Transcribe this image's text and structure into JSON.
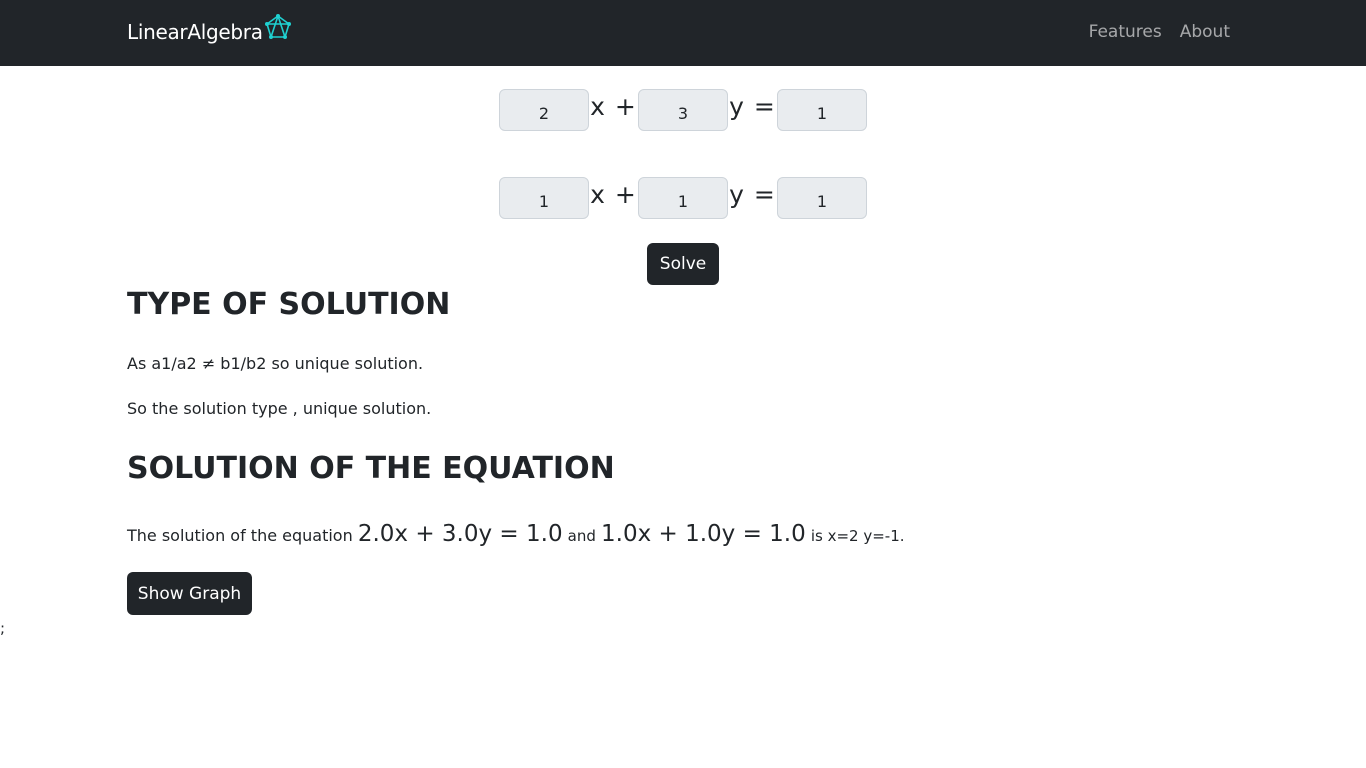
{
  "navbar": {
    "brand": "LinearAlgebra",
    "brand_icon": "pentagon-graph-logo",
    "links": [
      "Features",
      "About"
    ]
  },
  "equations": [
    {
      "a": "2",
      "b": "3",
      "c": "1"
    },
    {
      "a": "1",
      "b": "1",
      "c": "1"
    }
  ],
  "operators": {
    "x_plus": "x +",
    "y_eq": "y ="
  },
  "solve_label": "Solve",
  "type_section": {
    "heading": "TYPE OF SOLUTION",
    "line1": "As a1/a2 ≠ b1/b2 so unique solution.",
    "line2": "So the solution type , unique solution."
  },
  "solution_section": {
    "heading": "SOLUTION OF THE EQUATION",
    "prefix": "The solution of the equation",
    "eq1": "2.0x + 3.0y = 1.0",
    "connector": "and",
    "eq2": "1.0x + 1.0y = 1.0",
    "result": "is x=2 y=-1."
  },
  "show_graph_label": "Show Graph",
  "stray_text": ";",
  "colors": {
    "navbar": "#212529",
    "accent_logo": "#1fd1d1",
    "input_bg": "#e9ecef"
  }
}
